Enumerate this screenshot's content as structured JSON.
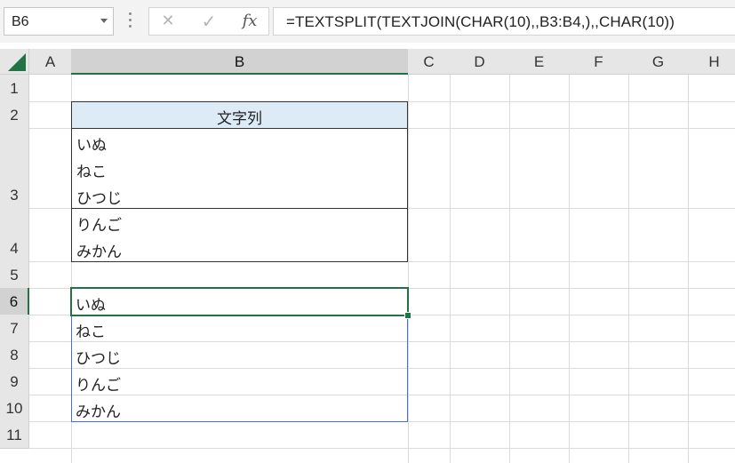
{
  "formula_bar": {
    "name_box": "B6",
    "cancel_icon": "✕",
    "enter_icon": "✓",
    "fx_icon": "fx",
    "formula": "=TEXTSPLIT(TEXTJOIN(CHAR(10),,B3:B4,),,CHAR(10))"
  },
  "columns": [
    "A",
    "B",
    "C",
    "D",
    "E",
    "F",
    "G",
    "H"
  ],
  "rows": [
    "1",
    "2",
    "3",
    "4",
    "5",
    "6",
    "7",
    "8",
    "9",
    "10",
    "11"
  ],
  "cells": {
    "B2": "文字列",
    "B3": [
      "いぬ",
      "ねこ",
      "ひつじ"
    ],
    "B4": [
      "りんご",
      "みかん"
    ],
    "B6": "いぬ",
    "B7": "ねこ",
    "B8": "ひつじ",
    "B9": "りんご",
    "B10": "みかん"
  },
  "colors": {
    "accent": "#217346",
    "header_fill": "#ddebf7",
    "spill_border": "#4472c4"
  }
}
